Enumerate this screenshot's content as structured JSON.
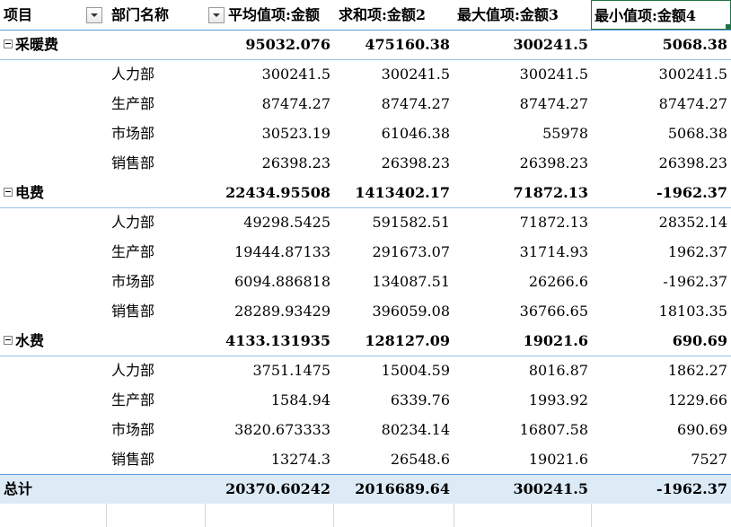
{
  "header": {
    "col0": "项目",
    "col1": "部门名称",
    "col2": "平均值项:金额",
    "col3": "求和项:金额2",
    "col4": "最大值项:金额3",
    "col5": "最小值项:金额4"
  },
  "rows": [
    {
      "type": "group",
      "item": "采暖费",
      "dept": "",
      "avg": "95032.076",
      "sum": "475160.38",
      "max": "300241.5",
      "min": "5068.38"
    },
    {
      "type": "detail",
      "item": "",
      "dept": "人力部",
      "avg": "300241.5",
      "sum": "300241.5",
      "max": "300241.5",
      "min": "300241.5"
    },
    {
      "type": "detail",
      "item": "",
      "dept": "生产部",
      "avg": "87474.27",
      "sum": "87474.27",
      "max": "87474.27",
      "min": "87474.27"
    },
    {
      "type": "detail",
      "item": "",
      "dept": "市场部",
      "avg": "30523.19",
      "sum": "61046.38",
      "max": "55978",
      "min": "5068.38"
    },
    {
      "type": "detail",
      "item": "",
      "dept": "销售部",
      "avg": "26398.23",
      "sum": "26398.23",
      "max": "26398.23",
      "min": "26398.23"
    },
    {
      "type": "group",
      "item": "电费",
      "dept": "",
      "avg": "22434.95508",
      "sum": "1413402.17",
      "max": "71872.13",
      "min": "-1962.37"
    },
    {
      "type": "detail",
      "item": "",
      "dept": "人力部",
      "avg": "49298.5425",
      "sum": "591582.51",
      "max": "71872.13",
      "min": "28352.14"
    },
    {
      "type": "detail",
      "item": "",
      "dept": "生产部",
      "avg": "19444.87133",
      "sum": "291673.07",
      "max": "31714.93",
      "min": "1962.37"
    },
    {
      "type": "detail",
      "item": "",
      "dept": "市场部",
      "avg": "6094.886818",
      "sum": "134087.51",
      "max": "26266.6",
      "min": "-1962.37"
    },
    {
      "type": "detail",
      "item": "",
      "dept": "销售部",
      "avg": "28289.93429",
      "sum": "396059.08",
      "max": "36766.65",
      "min": "18103.35"
    },
    {
      "type": "group",
      "item": "水费",
      "dept": "",
      "avg": "4133.131935",
      "sum": "128127.09",
      "max": "19021.6",
      "min": "690.69"
    },
    {
      "type": "detail",
      "item": "",
      "dept": "人力部",
      "avg": "3751.1475",
      "sum": "15004.59",
      "max": "8016.87",
      "min": "1862.27"
    },
    {
      "type": "detail",
      "item": "",
      "dept": "生产部",
      "avg": "1584.94",
      "sum": "6339.76",
      "max": "1993.92",
      "min": "1229.66"
    },
    {
      "type": "detail",
      "item": "",
      "dept": "市场部",
      "avg": "3820.673333",
      "sum": "80234.14",
      "max": "16807.58",
      "min": "690.69"
    },
    {
      "type": "detail",
      "item": "",
      "dept": "销售部",
      "avg": "13274.3",
      "sum": "26548.6",
      "max": "19021.6",
      "min": "7527"
    }
  ],
  "total": {
    "item": "总计",
    "avg": "20370.60242",
    "sum": "2016689.64",
    "max": "300241.5",
    "min": "-1962.37"
  },
  "colors": {
    "accent": "#217346",
    "total_fill": "#ddebf7",
    "line": "#9bc2e6"
  }
}
